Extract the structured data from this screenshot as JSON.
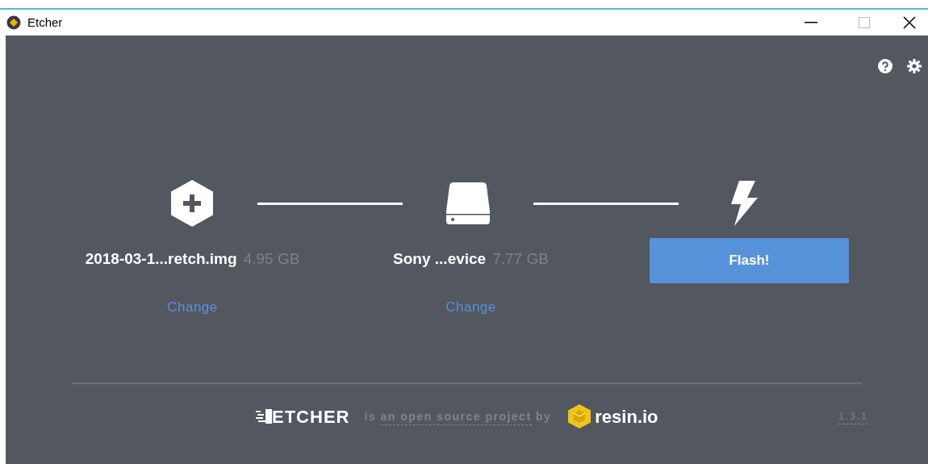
{
  "window": {
    "title": "Etcher"
  },
  "steps": [
    {
      "kind": "image",
      "name": "2018-03-1...retch.img",
      "size": "4.95 GB",
      "action": "Change"
    },
    {
      "kind": "drive",
      "name": "Sony ...evice",
      "size": "7.77 GB",
      "action": "Change"
    },
    {
      "kind": "flash",
      "button": "Flash!"
    }
  ],
  "footer": {
    "brand": "ETCHER",
    "before": "is",
    "link": "an open source project",
    "after": "by",
    "company": "resin.io",
    "version": "1.3.1"
  }
}
